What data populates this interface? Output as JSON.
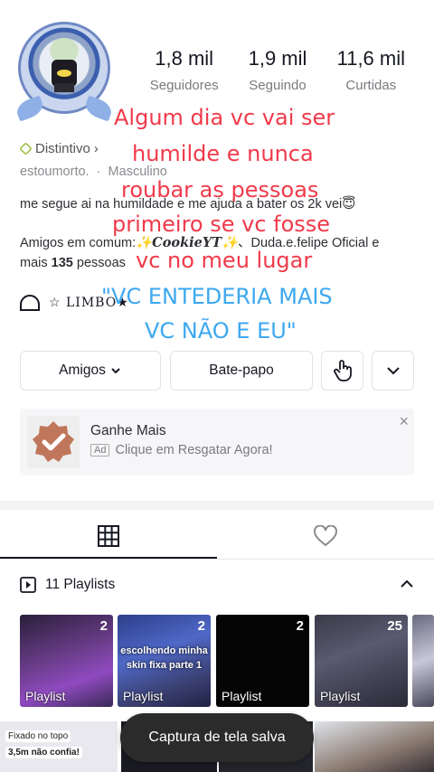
{
  "stats": [
    {
      "value": "1,8 mil",
      "label": "Seguidores"
    },
    {
      "value": "1,9 mil",
      "label": "Seguindo"
    },
    {
      "value": "11,6 mil",
      "label": "Curtidas"
    }
  ],
  "profile": {
    "badge_label": "Distintivo",
    "username": "estoumorto.",
    "separator": "·",
    "gender": "Masculino",
    "bio": "me segue ai na humildade e me ajuda a bater os 2k vei😇",
    "friends_prefix": "Amigos em comum:",
    "friend_1": "✨CookieYT✨",
    "friend_sep": "、",
    "friend_2": "Duda.e.felipe Oficial",
    "friends_and": "e",
    "friends_more_prefix": "mais",
    "friends_more_count": "135",
    "friends_more_suffix": "pessoas",
    "limbo_text": "☆ LIMBO★"
  },
  "overlay": {
    "red_lines": [
      "Algum dia vc vai ser",
      "humilde e nunca",
      "roubar as pessoas",
      "primeiro se vc fosse",
      "vc no meu lugar"
    ],
    "blue_lines": [
      "\"VC ENTEDERIA MAIS",
      "VC NÃO E EU\""
    ]
  },
  "actions": {
    "friends_label": "Amigos",
    "chat_label": "Bate-papo"
  },
  "ad": {
    "title": "Ganhe Mais",
    "tag": "Ad",
    "text": "Clique em Resgatar Agora!",
    "close": "×"
  },
  "playlists": {
    "header": "11 Playlists",
    "items": [
      {
        "count": "2",
        "label": "Playlist",
        "caption": ""
      },
      {
        "count": "2",
        "label": "Playlist",
        "caption": "escolhendo minha skin fixa parte 1"
      },
      {
        "count": "2",
        "label": "Playlist",
        "caption": ""
      },
      {
        "count": "25",
        "label": "Playlist",
        "caption": ""
      }
    ]
  },
  "bottom": {
    "pinned_label": "Fixado no topo",
    "pinned_caption": "3,5m não confia!",
    "toast": "Captura de tela salva"
  },
  "colors": {
    "overlay_red": "#f03a4a",
    "overlay_blue": "#3da8f0",
    "toast_bg": "#2b2b2b"
  }
}
